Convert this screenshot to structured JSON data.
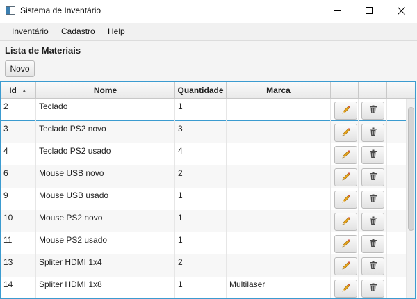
{
  "window": {
    "title": "Sistema de Inventário",
    "icon": "window-app-icon",
    "controls": [
      "minimize",
      "maximize",
      "close"
    ]
  },
  "menu": [
    "Inventário",
    "Cadastro",
    "Help"
  ],
  "page": {
    "title": "Lista de Materiais",
    "new_button": "Novo"
  },
  "table": {
    "columns": [
      "Id",
      "Nome",
      "Quantidade",
      "Marca",
      "",
      "",
      ""
    ],
    "sort": {
      "column": "Id",
      "direction": "ascending"
    },
    "actions": {
      "edit": "pencil-icon",
      "delete": "trash-icon"
    },
    "rows": [
      {
        "id": "2",
        "nome": "Teclado",
        "quantidade": "1",
        "marca": ""
      },
      {
        "id": "3",
        "nome": "Teclado PS2 novo",
        "quantidade": "3",
        "marca": ""
      },
      {
        "id": "4",
        "nome": "Teclado PS2 usado",
        "quantidade": "4",
        "marca": ""
      },
      {
        "id": "6",
        "nome": "Mouse USB novo",
        "quantidade": "2",
        "marca": ""
      },
      {
        "id": "9",
        "nome": "Mouse USB usado",
        "quantidade": "1",
        "marca": ""
      },
      {
        "id": "10",
        "nome": "Mouse PS2 novo",
        "quantidade": "1",
        "marca": ""
      },
      {
        "id": "11",
        "nome": "Mouse PS2 usado",
        "quantidade": "1",
        "marca": ""
      },
      {
        "id": "13",
        "nome": "Spliter HDMI 1x4",
        "quantidade": "2",
        "marca": ""
      },
      {
        "id": "14",
        "nome": "Spliter HDMI 1x8",
        "quantidade": "1",
        "marca": "Multilaser"
      }
    ]
  },
  "colors": {
    "accent_border": "#3b9bd0",
    "pencil": "#e8a41c",
    "trash": "#4a4a4a"
  }
}
